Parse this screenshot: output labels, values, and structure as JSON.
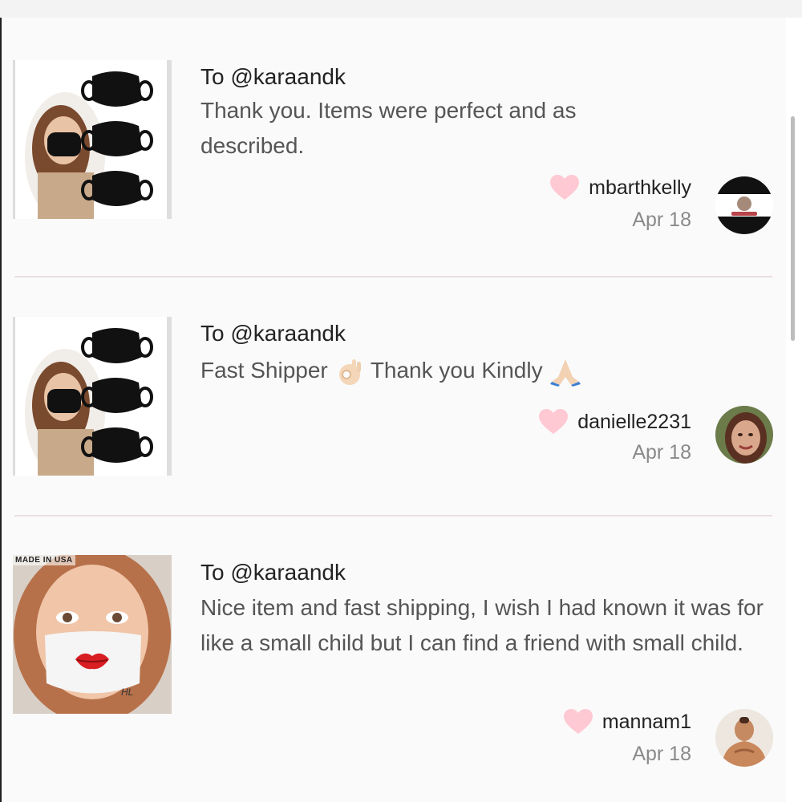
{
  "reviews": [
    {
      "to": "To @karaandk",
      "text": "Thank you. Items were perfect and as described.",
      "username": "mbarthkelly",
      "date": "Apr 18",
      "thumb_icon": "black-masks-photo",
      "avatar_icon": "profile-avatar"
    },
    {
      "to": "To @karaandk",
      "text_part1": "Fast Shipper",
      "text_part2": "Thank you Kindly",
      "username": "danielle2231",
      "date": "Apr 18",
      "thumb_icon": "black-masks-photo",
      "avatar_icon": "profile-avatar"
    },
    {
      "to": "To @karaandk",
      "text": "Nice item and fast shipping, I wish I had known it was for like a small child but I can find a friend with small child.",
      "username": "mannam1",
      "date": "Apr 18",
      "thumb_icon": "kids-lips-mask-photo",
      "thumb_badge": "MADE IN USA",
      "avatar_icon": "profile-avatar"
    }
  ],
  "colors": {
    "heart": "#ffc9d3",
    "username": "#222222",
    "date": "#8a8a8a",
    "divider": "#eadfe2",
    "background": "#fafafa"
  }
}
